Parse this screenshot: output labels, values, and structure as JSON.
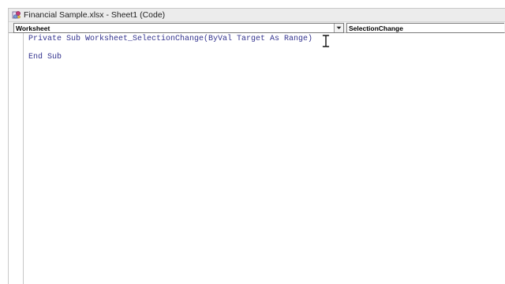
{
  "window": {
    "title": "Financial Sample.xlsx - Sheet1 (Code)",
    "icon": "vba-module-icon"
  },
  "object_combo": {
    "value": "Worksheet",
    "button_icon": "chevron-down-icon"
  },
  "procedure_combo": {
    "value": "SelectionChange"
  },
  "code": {
    "lines": [
      "Private Sub Worksheet_SelectionChange(ByVal Target As Range)",
      "",
      "End Sub"
    ],
    "text_color": "#32328e"
  },
  "cursor": {
    "icon": "text-ibeam-cursor-icon"
  }
}
